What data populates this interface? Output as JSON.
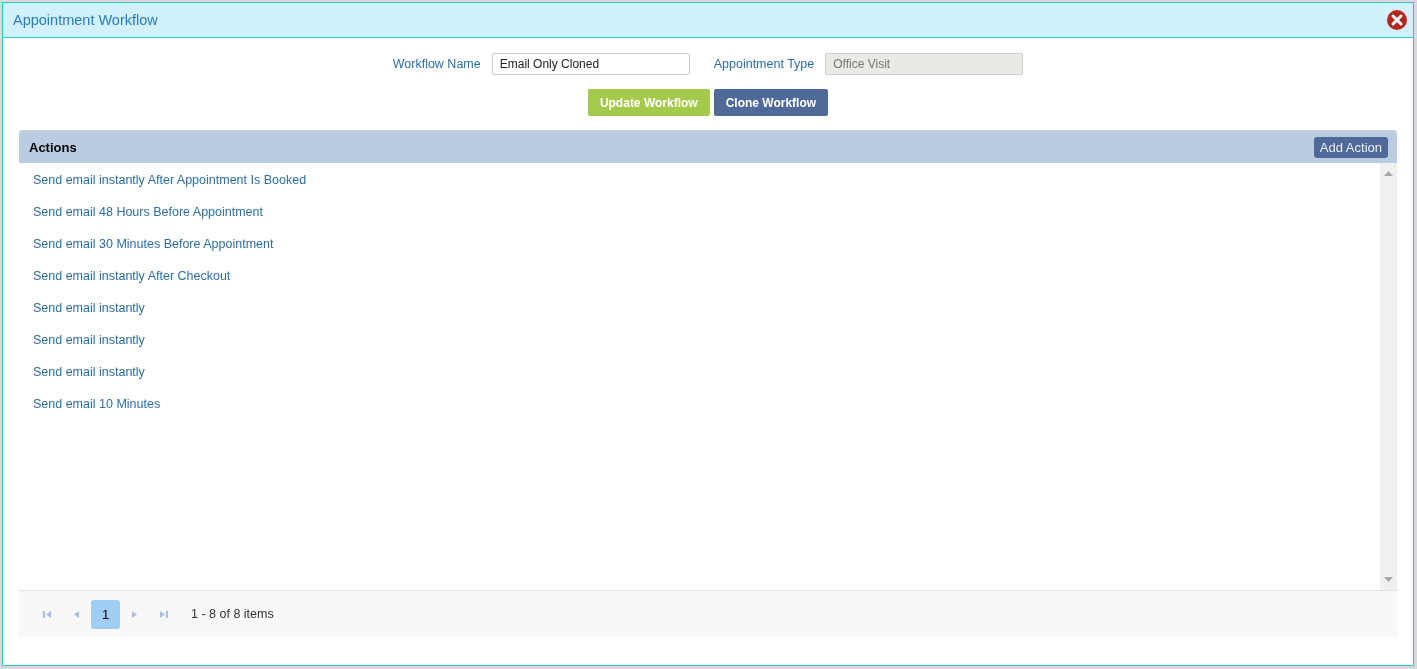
{
  "window": {
    "title": "Appointment Workflow"
  },
  "form": {
    "fields": [
      {
        "label": "Workflow Name",
        "value": "Email Only Cloned",
        "disabled": false
      },
      {
        "label": "Appointment Type",
        "value": "Office Visit",
        "disabled": true
      }
    ],
    "buttons": [
      {
        "label": "Update Workflow",
        "kind": "primary"
      },
      {
        "label": "Clone Workflow",
        "kind": "secondary"
      }
    ]
  },
  "actions": {
    "title": "Actions",
    "add_button": "Add Action",
    "items": [
      "Send email instantly After Appointment Is Booked",
      "Send email 48 Hours Before Appointment",
      "Send email 30 Minutes Before Appointment",
      "Send email instantly After Checkout",
      "Send email instantly",
      "Send email instantly",
      "Send email instantly",
      "Send email 10 Minutes"
    ]
  },
  "pager": {
    "pages": [
      {
        "label": "1",
        "selected": true
      }
    ],
    "summary": "1 - 8 of 8 items"
  }
}
